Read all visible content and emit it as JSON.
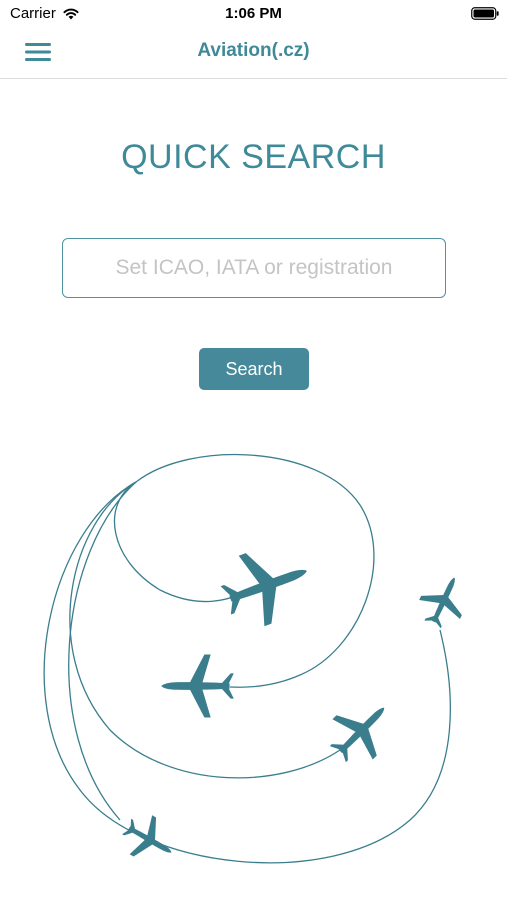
{
  "status_bar": {
    "carrier": "Carrier",
    "time": "1:06 PM",
    "wifi_icon": "wifi-icon",
    "battery_icon": "battery-icon"
  },
  "nav": {
    "title": "Aviation(.cz)",
    "menu_icon": "hamburger-menu-icon"
  },
  "main": {
    "heading": "QUICK SEARCH",
    "search": {
      "placeholder": "Set ICAO, IATA or registration",
      "value": ""
    },
    "search_button_label": "Search"
  },
  "colors": {
    "accent": "#3f8a99",
    "button": "#45899a",
    "illustration": "#3a7e8d"
  }
}
